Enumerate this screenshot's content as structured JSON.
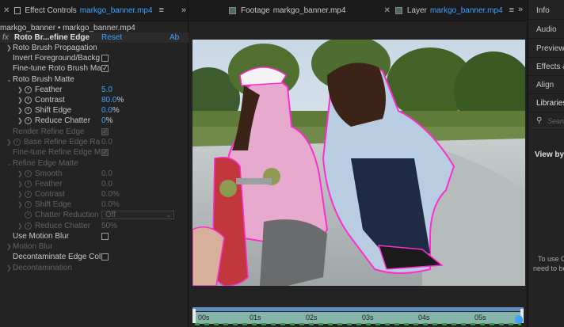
{
  "effect_panel": {
    "tab_title": "Effect Controls",
    "tab_file": "markgo_banner.mp4",
    "breadcrumb": "markgo_banner • markgo_banner.mp4",
    "effect_name": "Roto Br...efine Edge",
    "reset": "Reset",
    "about": "Ab",
    "props": {
      "roto_brush_propagation": "Roto Brush Propagation",
      "invert": "Invert Foreground/Backg",
      "fine_tune_matte": "Fine-tune Roto Brush Ma",
      "roto_brush_matte": "Roto Brush Matte",
      "feather": "Feather",
      "feather_val": "5.0",
      "contrast": "Contrast",
      "contrast_val": "80.0",
      "contrast_unit": "%",
      "shift_edge": "Shift Edge",
      "shift_edge_val": "0.0",
      "shift_edge_unit": "%",
      "reduce_chatter": "Reduce Chatter",
      "reduce_chatter_val": "0",
      "reduce_chatter_unit": "%",
      "render_refine_edge": "Render Refine Edge",
      "base_refine": "Base Refine Edge Ra",
      "base_refine_val": "0.0",
      "fine_tune_refine": "Fine-tune Refine Edge M",
      "refine_edge_matte": "Refine Edge Matte",
      "r_smooth": "Smooth",
      "r_smooth_val": "0.0",
      "r_feather": "Feather",
      "r_feather_val": "0.0",
      "r_contrast": "Contrast",
      "r_contrast_val": "0.0%",
      "r_shift": "Shift Edge",
      "r_shift_val": "0.0%",
      "r_chatter_red": "Chatter Reduction",
      "r_chatter_red_val": "Off",
      "r_reduce": "Reduce Chatter",
      "r_reduce_val": "50%",
      "use_motion_blur": "Use Motion Blur",
      "motion_blur": "Motion Blur",
      "decontaminate": "Decontaminate Edge Col",
      "decontamination": "Decontamination"
    }
  },
  "viewer": {
    "footage_tab": "Footage",
    "footage_file": "markgo_banner.mp4",
    "layer_tab": "Layer",
    "layer_file": "markgo_banner.mp4",
    "timeline_ticks": [
      "00s",
      "01s",
      "02s",
      "03s",
      "04s",
      "05s"
    ]
  },
  "right_panel": {
    "items": [
      "Info",
      "Audio",
      "Preview",
      "Effects &",
      "Align",
      "Libraries"
    ],
    "search_placeholder": "Search",
    "view_by": "View by T",
    "hint_line1": "To use C",
    "hint_line2": "need to be"
  },
  "colors": {
    "link": "#3ea3ff",
    "outline": "#ff2dd0"
  }
}
